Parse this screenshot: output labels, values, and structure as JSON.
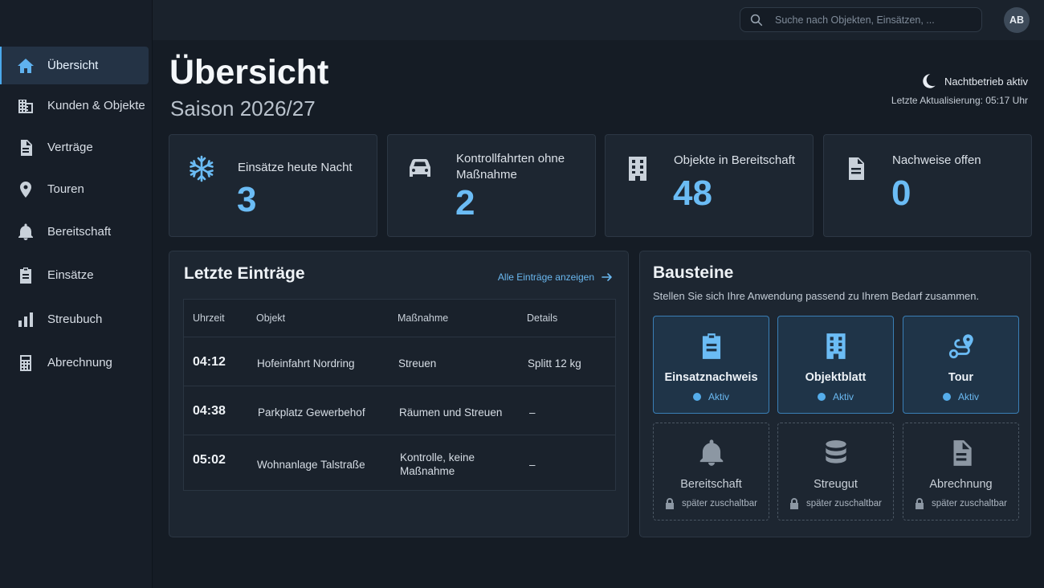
{
  "sidebar": {
    "items": [
      {
        "label": "Übersicht",
        "icon": "home-icon",
        "active": true
      },
      {
        "label": "Kunden & Objekte",
        "icon": "buildings-icon"
      },
      {
        "label": "Verträge",
        "icon": "document-icon"
      },
      {
        "label": "Touren",
        "icon": "map-pin-icon"
      },
      {
        "label": "Bereitschaft",
        "icon": "bell-icon"
      },
      {
        "label": "Einsätze",
        "icon": "clipboard-icon"
      },
      {
        "label": "Streubuch",
        "icon": "bar-chart-icon"
      },
      {
        "label": "Abrechnung",
        "icon": "calculator-icon"
      }
    ]
  },
  "topbar": {
    "search_placeholder": "Suche nach Objekten, Einsätzen, ...",
    "avatar_initials": "AB"
  },
  "header": {
    "title": "Übersicht",
    "subtitle": "Saison 2026/27",
    "night_mode": "Nachtbetrieb aktiv",
    "last_update": "Letzte Aktualisierung: 05:17 Uhr"
  },
  "stats": [
    {
      "label": "Einsätze heute Nacht",
      "value": "3",
      "icon": "snowflake-icon"
    },
    {
      "label": "Kontrollfahrten ohne Maßnahme",
      "value": "2",
      "icon": "car-icon"
    },
    {
      "label": "Objekte in Bereitschaft",
      "value": "48",
      "icon": "building-icon"
    },
    {
      "label": "Nachweise offen",
      "value": "0",
      "icon": "document-icon"
    }
  ],
  "recent": {
    "title": "Letzte Einträge",
    "show_all": "Alle Einträge anzeigen",
    "columns": [
      "Uhrzeit",
      "Objekt",
      "Maßnahme",
      "Details"
    ],
    "rows": [
      {
        "time": "04:12",
        "object": "Hofeinfahrt Nordring",
        "action": "Streuen",
        "details": "Splitt 12 kg"
      },
      {
        "time": "04:38",
        "object": "Parkplatz Gewerbehof",
        "action": "Räumen und Streuen",
        "details": "–"
      },
      {
        "time": "05:02",
        "object": "Wohnanlage Talstraße",
        "action": "Kontrolle, keine Maßnahme",
        "details": "–"
      }
    ]
  },
  "modules": {
    "title": "Bausteine",
    "description": "Stellen Sie sich Ihre Anwendung passend zu Ihrem Bedarf zusammen.",
    "items": [
      {
        "name": "Einsatznachweis",
        "status": "Aktiv",
        "active": true,
        "icon": "clipboard-icon"
      },
      {
        "name": "Objektblatt",
        "status": "Aktiv",
        "active": true,
        "icon": "building-icon"
      },
      {
        "name": "Tour",
        "status": "Aktiv",
        "active": true,
        "icon": "route-icon"
      },
      {
        "name": "Bereitschaft",
        "status": "später zuschaltbar",
        "active": false,
        "icon": "bell-icon"
      },
      {
        "name": "Streugut",
        "status": "später zuschaltbar",
        "active": false,
        "icon": "database-icon"
      },
      {
        "name": "Abrechnung",
        "status": "später zuschaltbar",
        "active": false,
        "icon": "document-icon"
      }
    ]
  },
  "colors": {
    "accent": "#6bbcf5",
    "background": "#151c25",
    "card": "#1d2631"
  }
}
